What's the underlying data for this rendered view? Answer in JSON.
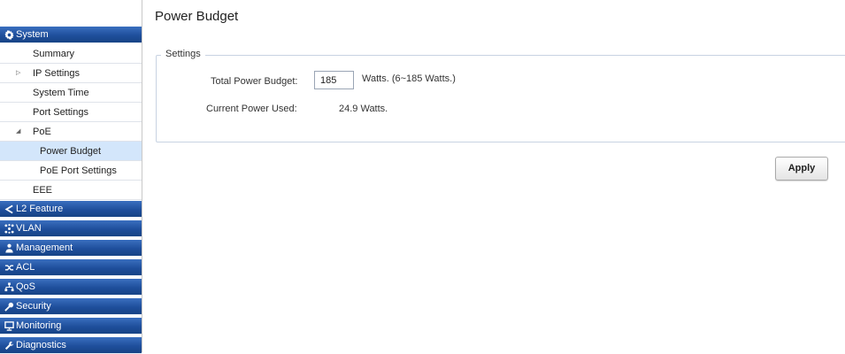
{
  "page": {
    "title": "Power Budget"
  },
  "sidebar": {
    "system": {
      "label": "System",
      "icon": "gear-icon"
    },
    "items": [
      {
        "label": "Summary"
      },
      {
        "label": "IP Settings"
      },
      {
        "label": "System Time"
      },
      {
        "label": "Port Settings"
      },
      {
        "label": "PoE"
      },
      {
        "label": "Power Budget"
      },
      {
        "label": "PoE Port Settings"
      },
      {
        "label": "EEE"
      }
    ],
    "categories": [
      {
        "label": "L2 Feature",
        "icon": "share-icon"
      },
      {
        "label": "VLAN",
        "icon": "network-icon"
      },
      {
        "label": "Management",
        "icon": "user-icon"
      },
      {
        "label": "ACL",
        "icon": "shuffle-icon"
      },
      {
        "label": "QoS",
        "icon": "sitemap-icon"
      },
      {
        "label": "Security",
        "icon": "key-icon"
      },
      {
        "label": "Monitoring",
        "icon": "monitor-icon"
      },
      {
        "label": "Diagnostics",
        "icon": "wrench-icon"
      }
    ]
  },
  "settings": {
    "legend": "Settings",
    "total_power_label": "Total Power Budget:",
    "total_power_value": "185",
    "total_power_hint": "Watts. (6~185 Watts.)",
    "current_power_label": "Current Power Used:",
    "current_power_value": "24.9 Watts."
  },
  "buttons": {
    "apply": "Apply"
  },
  "colors": {
    "sidebar_header": "#1f4f9c",
    "active_item": "#d3e6fb"
  }
}
